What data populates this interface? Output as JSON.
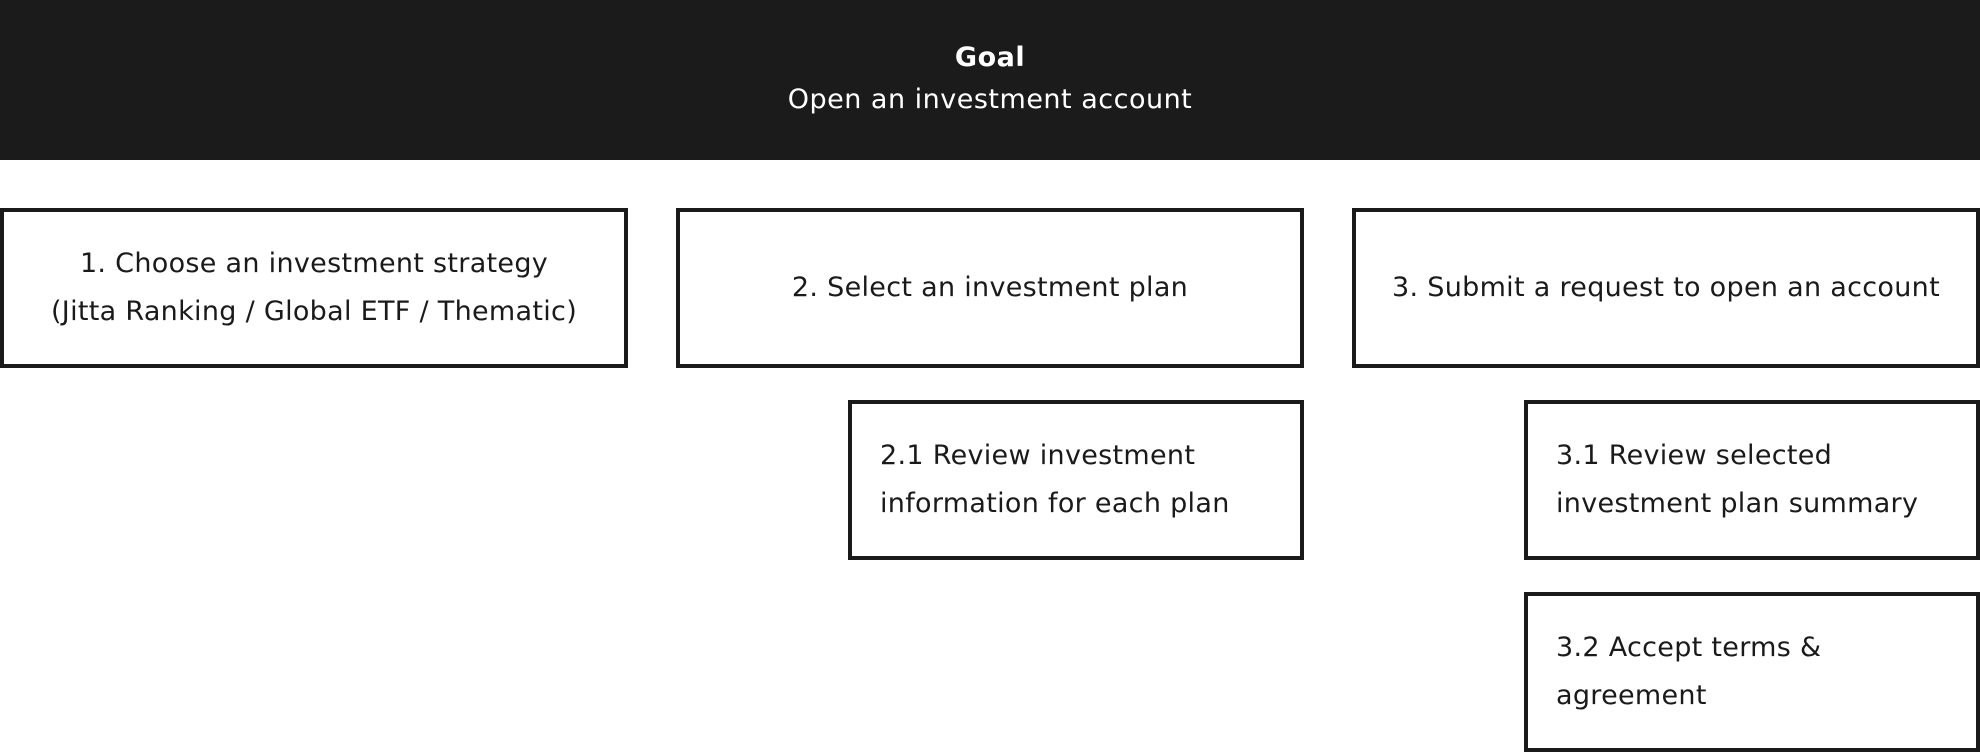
{
  "goal": {
    "label": "Goal",
    "text": "Open an investment account"
  },
  "steps": [
    {
      "text": "1. Choose an investment strategy\n(Jitta Ranking / Global ETF / Thematic)"
    },
    {
      "text": "2. Select an investment plan"
    },
    {
      "text": "3. Submit a request to open an account"
    }
  ],
  "substeps": {
    "step2": [
      {
        "text": "2.1 Review investment\ninformation for each plan"
      }
    ],
    "step3": [
      {
        "text": "3.1 Review selected\ninvestment plan summary"
      },
      {
        "text": "3.2 Accept terms &\nagreement"
      }
    ]
  },
  "colors": {
    "header_background": "#1b1b1b",
    "header_text": "#ffffff",
    "box_border": "#1a1a1a",
    "box_text": "#1a1a1a",
    "page_background": "#ffffff"
  }
}
